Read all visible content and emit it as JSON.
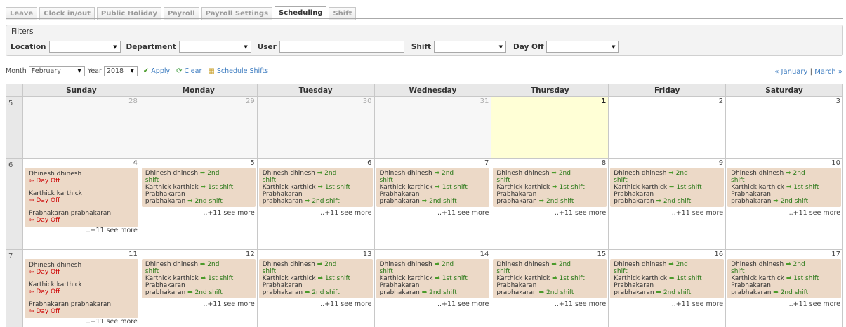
{
  "tabs": [
    "Leave",
    "Clock in/out",
    "Public Holiday",
    "Payroll",
    "Payroll Settings",
    "Scheduling",
    "Shift"
  ],
  "filters": {
    "title": "Filters",
    "location_label": "Location",
    "department_label": "Department",
    "user_label": "User",
    "shift_label": "Shift",
    "dayoff_label": "Day Off"
  },
  "controls": {
    "month_label": "Month",
    "month_value": "February",
    "year_label": "Year",
    "year_value": "2018",
    "apply": "Apply",
    "clear": "Clear",
    "schedule": "Schedule Shifts"
  },
  "nav": {
    "prev": "« January",
    "sep": "|",
    "next": "March »"
  },
  "days": [
    "Sunday",
    "Monday",
    "Tuesday",
    "Wednesday",
    "Thursday",
    "Friday",
    "Saturday"
  ],
  "weeks": [
    {
      "num": "5",
      "dates": [
        "28",
        "29",
        "30",
        "31",
        "1",
        "2",
        "3"
      ]
    },
    {
      "num": "6",
      "dates": [
        "4",
        "5",
        "6",
        "7",
        "8",
        "9",
        "10"
      ]
    },
    {
      "num": "7",
      "dates": [
        "11",
        "12",
        "13",
        "14",
        "15",
        "16",
        "17"
      ]
    }
  ],
  "sunday_entries": [
    {
      "name": "Dhinesh dhinesh",
      "status": "⇦ Day Off"
    },
    {
      "name": "Karthick karthick",
      "status": "⇦ Day Off"
    },
    {
      "name": "Prabhakaran prabhakaran",
      "status": "⇦ Day Off"
    }
  ],
  "weekday_lines": {
    "l1": "Dhinesh dhinesh",
    "l1s": "2nd",
    "l2": "shift",
    "l3": "Karthick karthick",
    "l3s": "1st shift",
    "l4": "Prabhakaran",
    "l5": "prabhakaran",
    "l5s": "2nd shift"
  },
  "see_more": "..+11 see more",
  "colors": {
    "accent": "#3a7abf",
    "event_bg": "#ecd9c7",
    "dayoff": "#cc0000",
    "shift": "#2c7a1a",
    "today": "#ffffd6"
  }
}
